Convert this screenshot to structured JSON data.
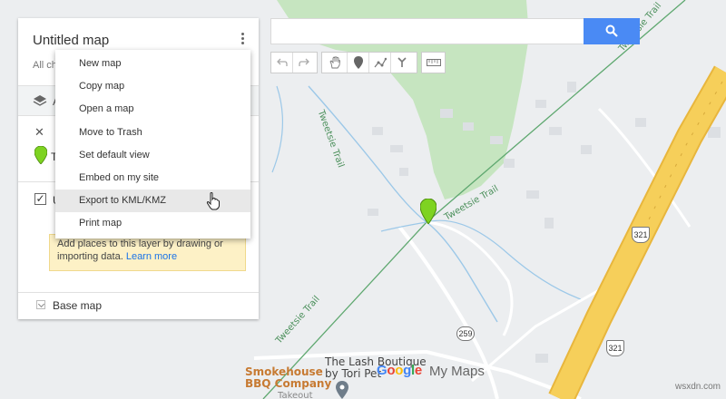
{
  "panel": {
    "title": "Untitled map",
    "subtitle_partial": "All ch",
    "toolbar_letter": "A",
    "pin_row_letter": "T",
    "layer_letter": "U",
    "layer_check": "✓",
    "notice": {
      "text": "Add places to this layer by drawing or importing data.",
      "link": "Learn more"
    },
    "base_map_label": "Base map"
  },
  "menu": {
    "items": [
      {
        "label": "New map",
        "highlighted": false
      },
      {
        "label": "Copy map",
        "highlighted": false
      },
      {
        "label": "Open a map",
        "highlighted": false
      },
      {
        "label": "Move to Trash",
        "highlighted": false
      },
      {
        "label": "Set default view",
        "highlighted": false
      },
      {
        "label": "Embed on my site",
        "highlighted": false
      },
      {
        "label": "Export to KML/KMZ",
        "highlighted": true
      },
      {
        "label": "Print map",
        "highlighted": false
      }
    ]
  },
  "search": {
    "value": "",
    "placeholder": ""
  },
  "tools": [
    "undo-icon",
    "redo-icon",
    "hand-icon",
    "marker-icon",
    "draw-line-icon",
    "directions-icon",
    "ruler-icon"
  ],
  "map": {
    "trail_labels": [
      "Tweetsie Trail",
      "Tweetsie Trail",
      "Tweetsie Trail"
    ],
    "shields": [
      "321",
      "321",
      "259"
    ],
    "pois": {
      "smokehouse": [
        "Smokehouse",
        "BBQ Company",
        "Takeout"
      ],
      "lash": [
        "The Lash Boutique",
        "by Tori Pet"
      ]
    }
  },
  "footer": {
    "logo_letters": [
      "G",
      "o",
      "o",
      "g",
      "l",
      "e"
    ],
    "product": "My Maps",
    "watermark": "wsxdn.com"
  },
  "colors": {
    "accent": "#4a8af4",
    "green_area": "#c6e5c0",
    "highway": "#f6cf5a",
    "trail": "#5fa870",
    "water": "#9cc8e8",
    "marker": "#7ed321",
    "notice_bg": "#fdf1c6"
  }
}
